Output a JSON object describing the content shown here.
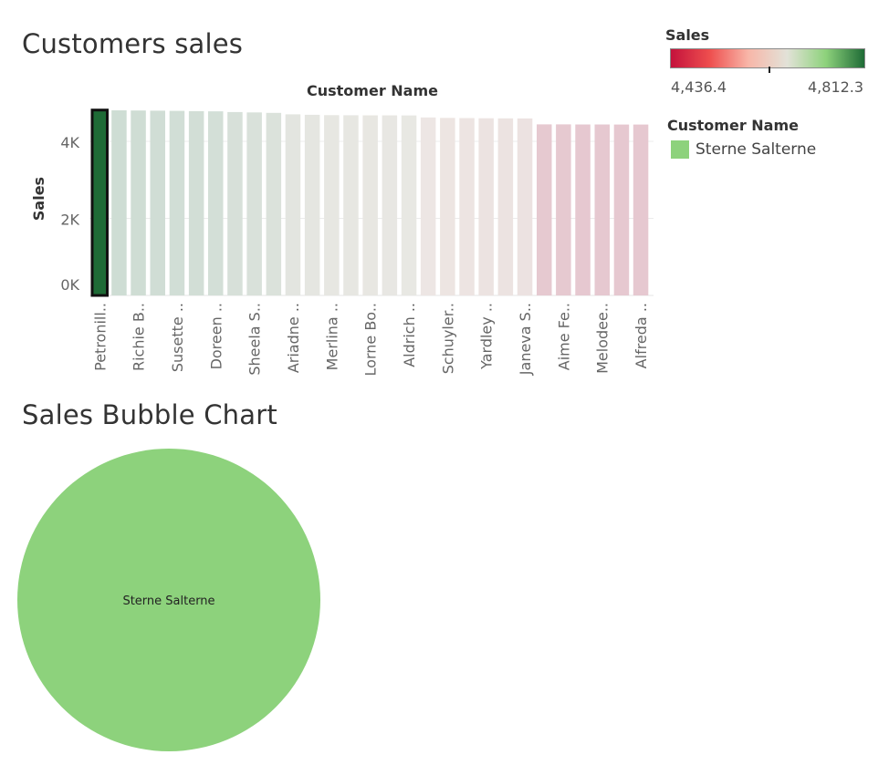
{
  "bar_chart": {
    "title": "Customers sales"
  },
  "bubble_chart": {
    "title": "Sales Bubble Chart"
  },
  "legend": {
    "sales_title": "Sales",
    "sales_min": "4,436.4",
    "sales_max": "4,812.3",
    "customer_title": "Customer Name",
    "customer_item": "Sterne Salterne"
  },
  "colors": {
    "highlight": "#8dd27c",
    "bar_low": "#e6c8d0",
    "bar_high": "#cddcd3",
    "selected_bar": "#1e6b36",
    "gradient_stops": [
      "#c4123c",
      "#ee4e4e",
      "#f8b6a8",
      "#e2e2d8",
      "#8ed27c",
      "#1e6b36"
    ]
  },
  "chart_data": [
    {
      "type": "bar",
      "title": "Customers sales",
      "xlabel": "Customer Name",
      "ylabel": "Sales",
      "ylim": [
        0,
        4900
      ],
      "yticks": [
        "0K",
        "2K",
        "4K"
      ],
      "ytick_values": [
        0,
        2000,
        4000
      ],
      "categories": [
        "Petronill..",
        "",
        "Richie B..",
        "",
        "Susette ..",
        "",
        "Doreen ..",
        "",
        "Sheela S..",
        "",
        "Ariadne ..",
        "",
        "Merlina ..",
        "",
        "Lorne Bo..",
        "",
        "Aldrich ..",
        "",
        "Schuyler..",
        "",
        "Yardley ..",
        "",
        "Janeva S..",
        "",
        "Aime Fe..",
        "",
        "Melodee..",
        "",
        "Alfreda .."
      ],
      "values": [
        4812.3,
        4806,
        4800,
        4795,
        4790,
        4785,
        4780,
        4760,
        4750,
        4740,
        4700,
        4690,
        4680,
        4678,
        4676,
        4674,
        4672,
        4620,
        4610,
        4605,
        4600,
        4598,
        4595,
        4440,
        4440,
        4439,
        4438,
        4437,
        4436.4
      ],
      "selected_index": 0,
      "grid": true
    },
    {
      "type": "bubble",
      "title": "Sales Bubble Chart",
      "labels": [
        "Sterne Salterne"
      ],
      "values": [
        4812.3
      ]
    }
  ]
}
